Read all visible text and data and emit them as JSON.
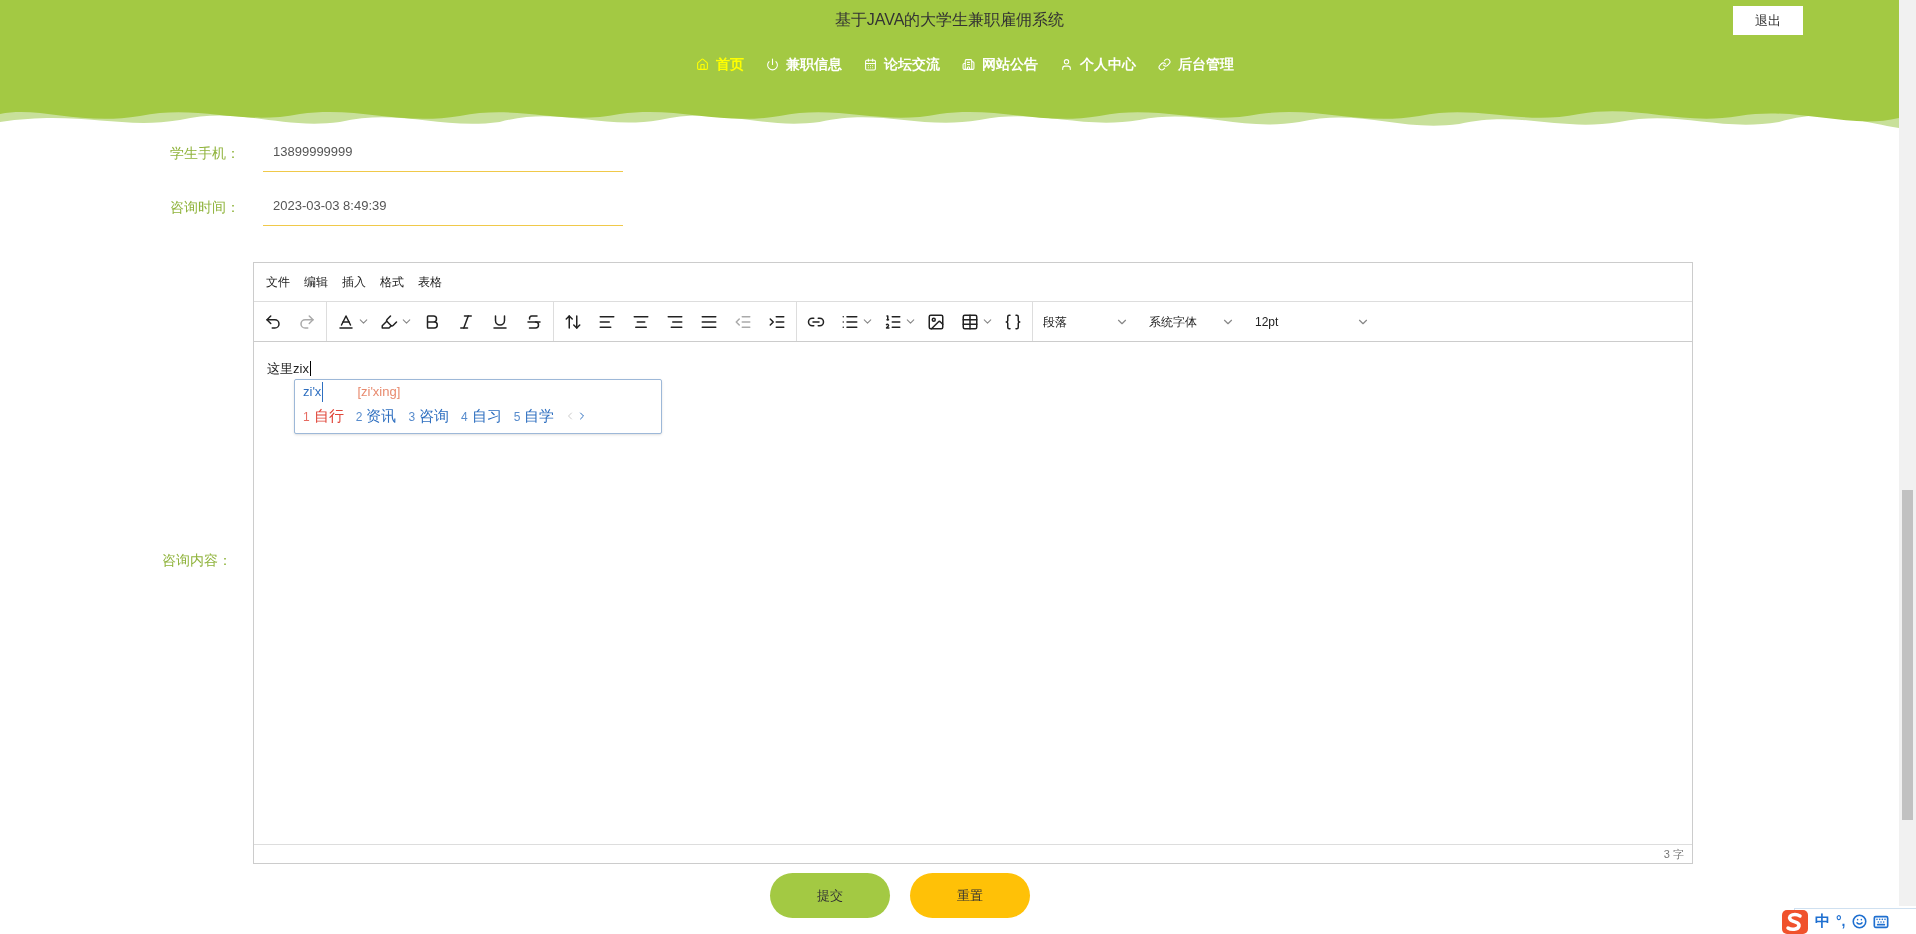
{
  "header": {
    "title": "基于JAVA的大学生兼职雇佣系统",
    "logout": "退出",
    "nav": [
      {
        "label": "首页",
        "selected": true
      },
      {
        "label": "兼职信息",
        "selected": false
      },
      {
        "label": "论坛交流",
        "selected": false
      },
      {
        "label": "网站公告",
        "selected": false
      },
      {
        "label": "个人中心",
        "selected": false
      },
      {
        "label": "后台管理",
        "selected": false
      }
    ]
  },
  "form": {
    "fields": [
      {
        "label": "学生手机：",
        "value": "13899999999"
      },
      {
        "label": "咨询时间：",
        "value": "2023-03-03 8:49:39"
      }
    ],
    "editor": {
      "label": "咨询内容：",
      "menu": [
        "文件",
        "编辑",
        "插入",
        "格式",
        "表格"
      ],
      "dropdowns": [
        "段落",
        "系统字体",
        "12pt"
      ],
      "content": "这里zix",
      "word_count": "3 字"
    },
    "buttons": [
      {
        "label": "提交",
        "kind": "submit"
      },
      {
        "label": "重置",
        "kind": "reset"
      }
    ]
  },
  "ime": {
    "composition": "zi'x",
    "suggestion": "[zi'xing]",
    "candidates": [
      {
        "number": "1",
        "text": "自行",
        "selected": true
      },
      {
        "number": "2",
        "text": "资讯",
        "selected": false
      },
      {
        "number": "3",
        "text": "咨询",
        "selected": false
      },
      {
        "number": "4",
        "text": "自习",
        "selected": false
      },
      {
        "number": "5",
        "text": "自学",
        "selected": false
      }
    ],
    "status": {
      "mode": "中",
      "punctuation": "°,"
    }
  }
}
